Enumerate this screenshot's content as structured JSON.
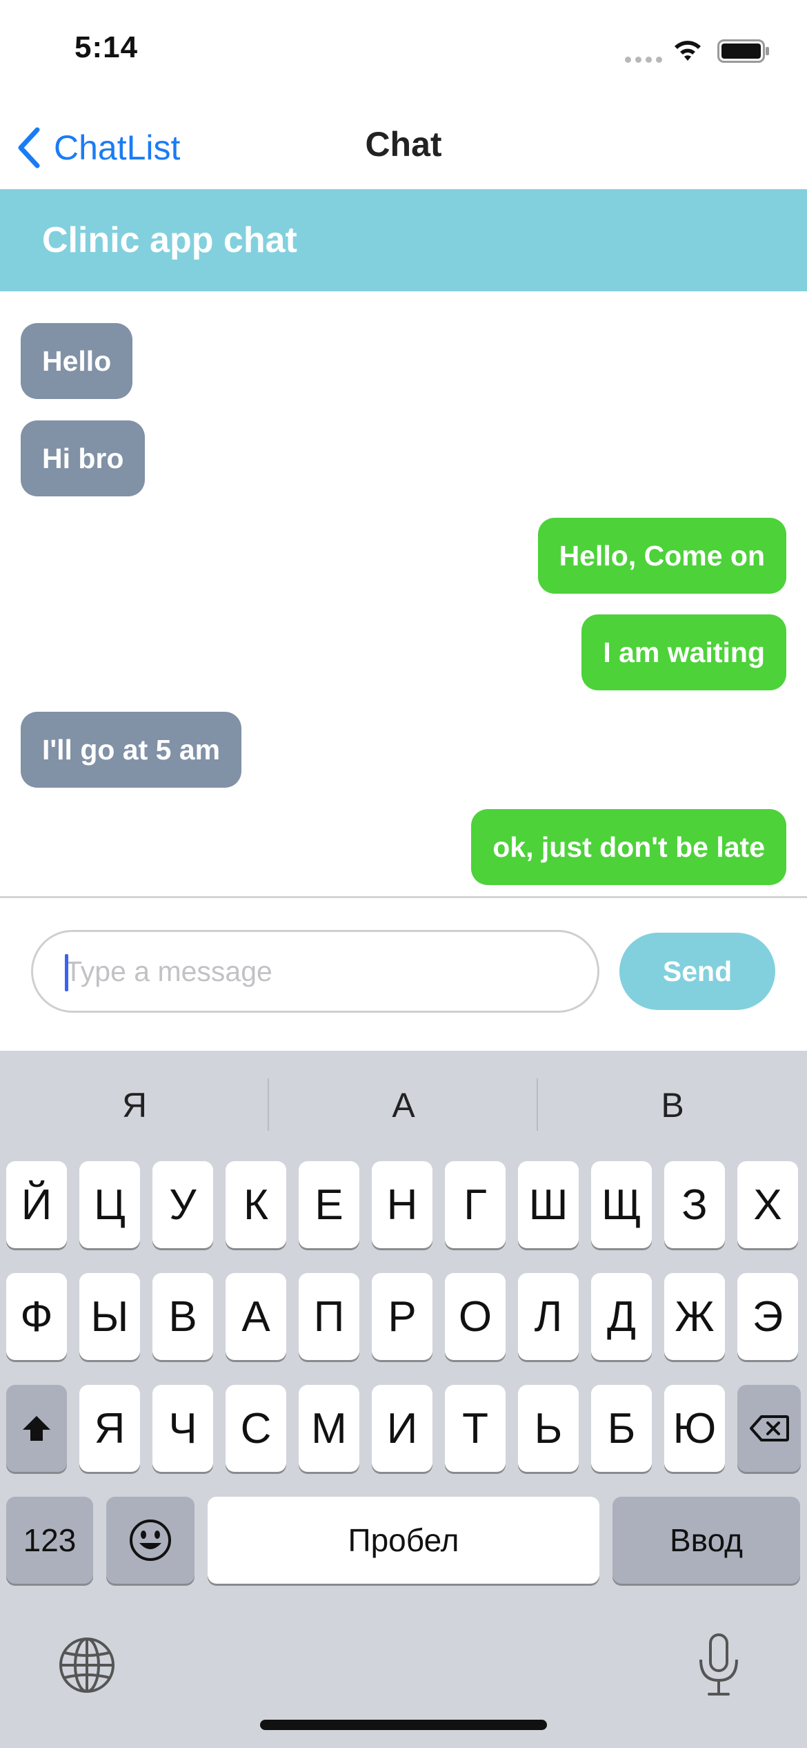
{
  "status_bar": {
    "time": "5:14"
  },
  "nav": {
    "back_label": "ChatList",
    "title": "Chat"
  },
  "chat_header": {
    "title": "Clinic app chat"
  },
  "messages": [
    {
      "text": "Hello",
      "direction": "received"
    },
    {
      "text": "Hi bro",
      "direction": "received"
    },
    {
      "text": "Hello, Come on",
      "direction": "sent"
    },
    {
      "text": "I am waiting",
      "direction": "sent"
    },
    {
      "text": "I'll go at 5 am",
      "direction": "received"
    },
    {
      "text": "ok, just don't be late",
      "direction": "sent"
    }
  ],
  "input": {
    "placeholder": "Type a message",
    "value": ""
  },
  "send_button": {
    "label": "Send"
  },
  "keyboard": {
    "suggestions": [
      "Я",
      "А",
      "В"
    ],
    "row1": [
      "Й",
      "Ц",
      "У",
      "К",
      "Е",
      "Н",
      "Г",
      "Ш",
      "Щ",
      "З",
      "Х"
    ],
    "row2": [
      "Ф",
      "Ы",
      "В",
      "А",
      "П",
      "Р",
      "О",
      "Л",
      "Д",
      "Ж",
      "Э"
    ],
    "row3": [
      "Я",
      "Ч",
      "С",
      "М",
      "И",
      "Т",
      "Ь",
      "Б",
      "Ю"
    ],
    "numbers_key": "123",
    "space_key": "Пробел",
    "return_key": "Ввод"
  },
  "colors": {
    "header": "#82d0de",
    "received_bubble": "#8191a6",
    "sent_bubble": "#4dd23a",
    "link": "#1a7cf5",
    "keyboard_bg": "#d1d4da"
  },
  "icons": [
    "wifi-icon",
    "battery-icon",
    "back-chevron-icon",
    "shift-icon",
    "backspace-icon",
    "emoji-icon",
    "globe-icon",
    "microphone-icon"
  ]
}
